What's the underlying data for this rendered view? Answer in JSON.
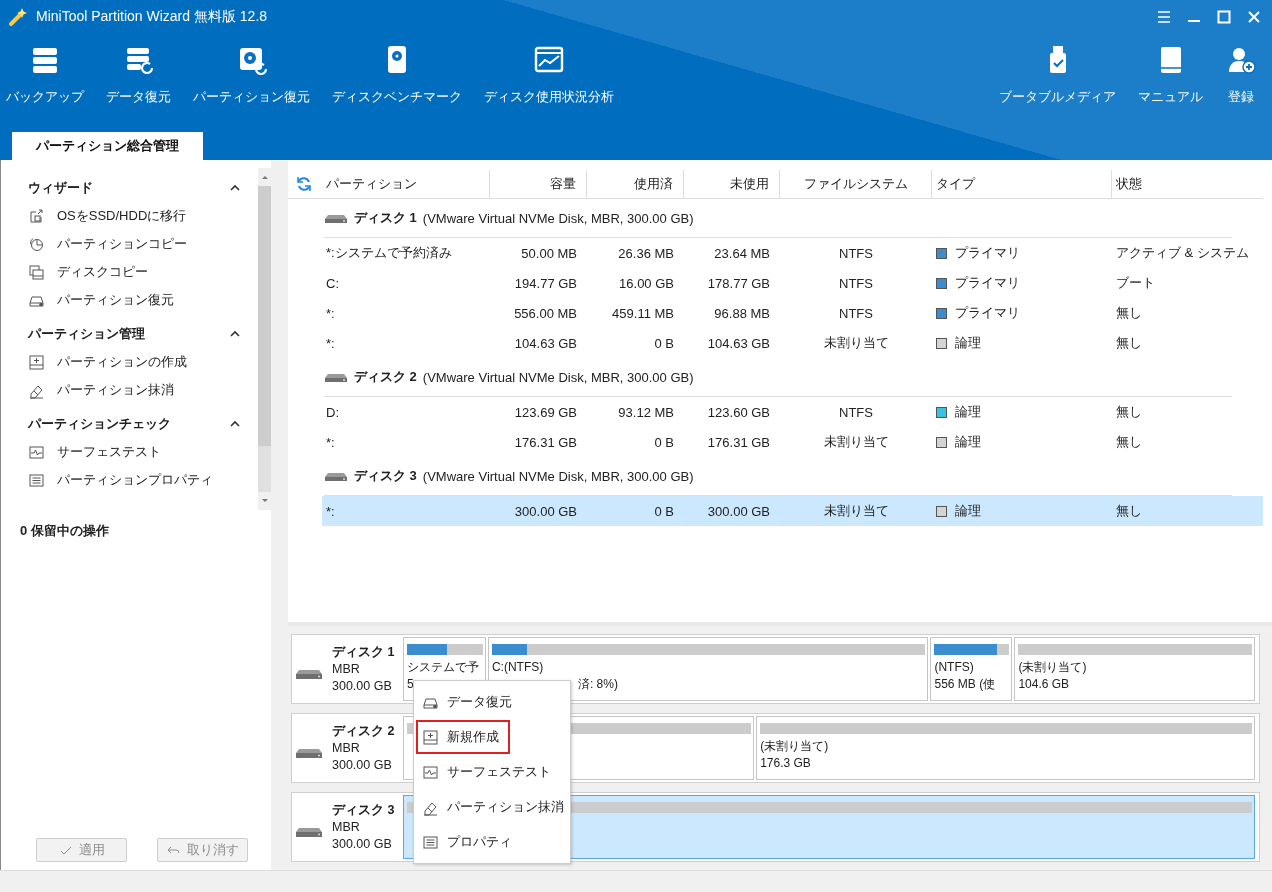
{
  "window": {
    "title": "MiniTool Partition Wizard 無料版 12.8"
  },
  "toolbar": {
    "left": [
      {
        "label": "バックアップ"
      },
      {
        "label": "データ復元"
      },
      {
        "label": "パーティション復元"
      },
      {
        "label": "ディスクベンチマーク"
      },
      {
        "label": "ディスク使用状況分析"
      }
    ],
    "right": [
      {
        "label": "ブータブルメディア"
      },
      {
        "label": "マニュアル"
      },
      {
        "label": "登録"
      }
    ]
  },
  "tabs": [
    {
      "label": "パーティション総合管理",
      "selected": true
    }
  ],
  "sidebar": {
    "sections": [
      {
        "title": "ウィザード",
        "expanded": true,
        "items": [
          "OSをSSD/HDDに移行",
          "パーティションコピー",
          "ディスクコピー",
          "パーティション復元"
        ]
      },
      {
        "title": "パーティション管理",
        "expanded": true,
        "items": [
          "パーティションの作成",
          "パーティション抹消"
        ]
      },
      {
        "title": "パーティションチェック",
        "expanded": true,
        "items": [
          "サーフェステスト",
          "パーティションプロパティ"
        ]
      }
    ],
    "pending": "0 保留中の操作"
  },
  "buttons": [
    {
      "label": "適用",
      "disabled": true
    },
    {
      "label": "取り消す",
      "disabled": true
    }
  ],
  "table": {
    "columns": [
      "パーティション",
      "容量",
      "使用済",
      "未使用",
      "ファイルシステム",
      "タイプ",
      "状態"
    ],
    "disks": [
      {
        "name": "ディスク 1",
        "detail": "(VMware Virtual NVMe Disk, MBR, 300.00 GB)",
        "rows": [
          {
            "cells": [
              "*:システムで予約済み",
              "50.00 MB",
              "26.36 MB",
              "23.64 MB",
              "NTFS"
            ],
            "type": "プライマリ",
            "color": "#3c8dce",
            "status": "アクティブ & システム",
            "selected": false
          },
          {
            "cells": [
              "C:",
              "194.77 GB",
              "16.00 GB",
              "178.77 GB",
              "NTFS"
            ],
            "type": "プライマリ",
            "color": "#3c8dce",
            "status": "ブート",
            "selected": false
          },
          {
            "cells": [
              "*:",
              "556.00 MB",
              "459.11 MB",
              "96.88 MB",
              "NTFS"
            ],
            "type": "プライマリ",
            "color": "#3c8dce",
            "status": "無し",
            "selected": false
          },
          {
            "cells": [
              "*:",
              "104.63 GB",
              "0 B",
              "104.63 GB",
              "未割り当て"
            ],
            "type": "論理",
            "color": "#d4d4d4",
            "status": "無し",
            "selected": false
          }
        ]
      },
      {
        "name": "ディスク 2",
        "detail": "(VMware Virtual NVMe Disk, MBR, 300.00 GB)",
        "rows": [
          {
            "cells": [
              "D:",
              "123.69 GB",
              "93.12 MB",
              "123.60 GB",
              "NTFS"
            ],
            "type": "論理",
            "color": "#38c2e3",
            "status": "無し",
            "selected": false
          },
          {
            "cells": [
              "*:",
              "176.31 GB",
              "0 B",
              "176.31 GB",
              "未割り当て"
            ],
            "type": "論理",
            "color": "#d4d4d4",
            "status": "無し",
            "selected": false
          }
        ]
      },
      {
        "name": "ディスク 3",
        "detail": "(VMware Virtual NVMe Disk, MBR, 300.00 GB)",
        "rows": [
          {
            "cells": [
              "*:",
              "300.00 GB",
              "0 B",
              "300.00 GB",
              "未割り当て"
            ],
            "type": "論理",
            "color": "#d4d4d4",
            "status": "無し",
            "selected": true
          }
        ]
      }
    ]
  },
  "disk_map": [
    {
      "name": "ディスク 1",
      "scheme": "MBR",
      "size": "300.00 GB",
      "partitions": [
        {
          "label": "システムで予",
          "info": "5",
          "level": 0.53,
          "selected": false
        },
        {
          "label": "C:(NTFS)",
          "info": "済: 8%)",
          "level": 0.08,
          "selected": false
        },
        {
          "label": "(NTFS)",
          "info": "556 MB (使",
          "level": 0.83,
          "selected": false
        },
        {
          "label": "(未割り当て)",
          "info": "104.6 GB",
          "level": 0,
          "selected": false
        }
      ]
    },
    {
      "name": "ディスク 2",
      "scheme": "MBR",
      "size": "300.00 GB",
      "partitions": [
        {
          "level": 0,
          "selected": false
        },
        {
          "label": "(未割り当て)",
          "info": "176.3 GB",
          "level": 0,
          "selected": false
        }
      ]
    },
    {
      "name": "ディスク 3",
      "scheme": "MBR",
      "size": "300.00 GB",
      "partitions": [
        {
          "level": 0,
          "selected": true
        }
      ]
    }
  ],
  "context_menu": {
    "items": [
      {
        "label": "データ復元",
        "selected": false
      },
      {
        "label": "新規作成",
        "selected": true
      },
      {
        "label": "サーフェステスト",
        "selected": false
      },
      {
        "label": "パーティション抹消",
        "selected": false
      },
      {
        "label": "プロパティ",
        "selected": false
      }
    ]
  }
}
